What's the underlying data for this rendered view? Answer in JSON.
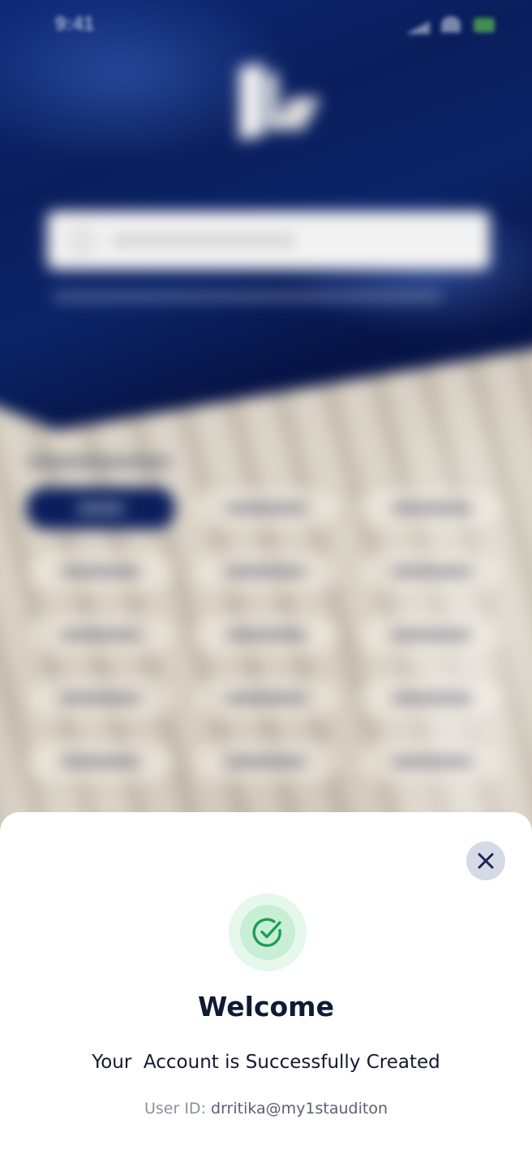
{
  "status_bar": {
    "time": "9:41"
  },
  "background_screen": {
    "description_hidden": true
  },
  "modal": {
    "close_icon": "close-icon",
    "success_icon": "check-circle-icon",
    "title": "Welcome",
    "message": "Your  Account is Successfully Created",
    "user_id_label": "User ID:",
    "user_id_value": "drritika@my1stauditon"
  },
  "colors": {
    "hero_blue": "#0a1e5c",
    "success_green": "#1f9e55",
    "close_bg": "#d6d9e6",
    "close_x": "#1b2450",
    "title_text": "#111a33"
  }
}
